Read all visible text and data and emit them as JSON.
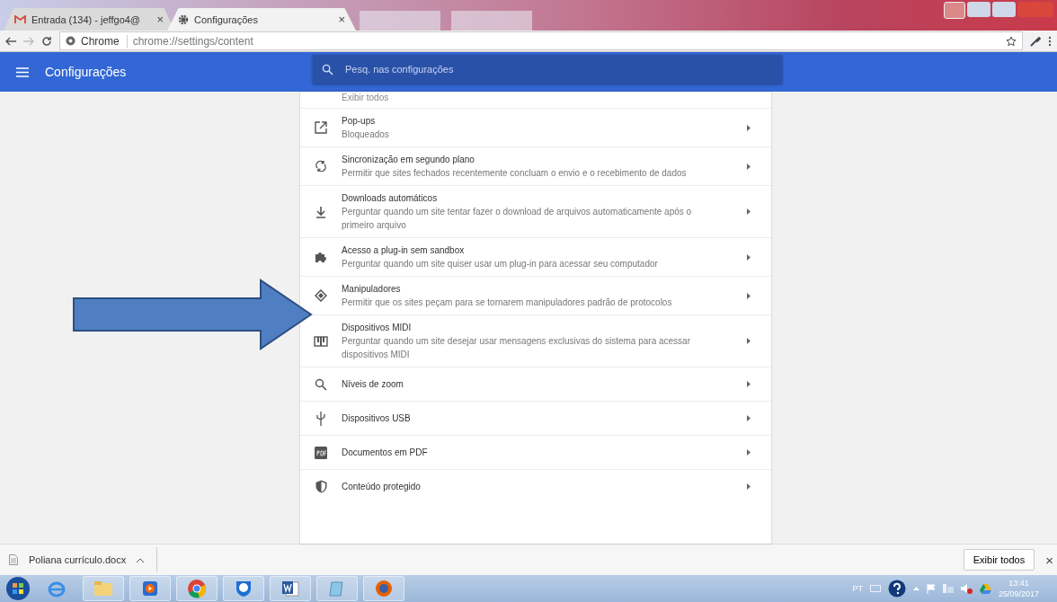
{
  "tabs": [
    {
      "title": "Entrada (134) - jeffgo4@",
      "selected": false,
      "close": "×"
    },
    {
      "title": "Configurações",
      "selected": true,
      "close": "×"
    }
  ],
  "address_bar": {
    "site_label": "Chrome",
    "url": "chrome://settings/content"
  },
  "header": {
    "title": "Configurações",
    "search": {
      "placeholder": "Pesq. nas configurações"
    }
  },
  "content": {
    "partial_text": "Exibir todos",
    "items": [
      {
        "title": "Pop-ups",
        "description": "Bloqueados"
      },
      {
        "title": "Sincronização em segundo plano",
        "description": "Permitir que sites fechados recentemente concluam o envio e o recebimento de dados"
      },
      {
        "title": "Downloads automáticos",
        "description": "Perguntar quando um site tentar fazer o download de arquivos automaticamente após o primeiro arquivo"
      },
      {
        "title": "Acesso a plug-in sem sandbox",
        "description": "Perguntar quando um site quiser usar um plug-in para acessar seu computador"
      },
      {
        "title": "Manipuladores",
        "description": "Permitir que os sites peçam para se tornarem manipuladores padrão de protocolos"
      },
      {
        "title": "Dispositivos MIDI",
        "description": "Perguntar quando um site desejar usar mensagens exclusivas do sistema para acessar dispositivos MIDI"
      },
      {
        "title": "Níveis de zoom"
      },
      {
        "title": "Dispositivos USB"
      },
      {
        "title": "Documentos em PDF"
      },
      {
        "title": "Conteúdo protegido"
      }
    ]
  },
  "download_shelf": {
    "file": "Poliana currículo.docx",
    "show_all": "Exibir todos",
    "close": "×"
  },
  "taskbar": {
    "language": "PT",
    "time": "13:41",
    "date": "25/09/2017"
  }
}
